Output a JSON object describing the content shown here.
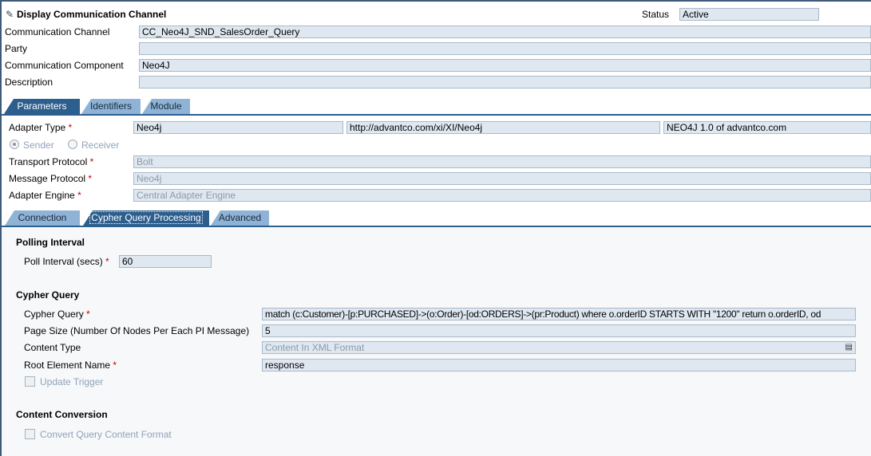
{
  "header": {
    "title": "Display Communication Channel",
    "status_label": "Status",
    "status_value": "Active"
  },
  "fields": {
    "channel": {
      "label": "Communication Channel",
      "value": "CC_Neo4J_SND_SalesOrder_Query"
    },
    "party": {
      "label": "Party",
      "value": ""
    },
    "component": {
      "label": "Communication Component",
      "value": "Neo4J"
    },
    "description": {
      "label": "Description",
      "value": ""
    }
  },
  "tabs": [
    "Parameters",
    "Identifiers",
    "Module"
  ],
  "params": {
    "adapter_type": {
      "label": "Adapter Type",
      "values": [
        "Neo4j",
        "http://advantco.com/xi/XI/Neo4j",
        "NEO4J 1.0 of advantco.com"
      ]
    },
    "sender": "Sender",
    "receiver": "Receiver",
    "transport": {
      "label": "Transport Protocol",
      "value": "Bolt"
    },
    "message": {
      "label": "Message Protocol",
      "value": "Neo4j"
    },
    "engine": {
      "label": "Adapter Engine",
      "value": "Central Adapter Engine"
    },
    "required": "*"
  },
  "subtabs": [
    "Connection",
    "Cypher Query Processing",
    "Advanced"
  ],
  "polling": {
    "heading": "Polling Interval",
    "label": "Poll Interval (secs)",
    "value": "60"
  },
  "cypher": {
    "heading": "Cypher Query",
    "query": {
      "label": "Cypher Query",
      "value": "match (c:Customer)-[p:PURCHASED]->(o:Order)-[od:ORDERS]->(pr:Product) where o.orderID STARTS WITH \"1200\" return o.orderID, od"
    },
    "page_size": {
      "label": "Page Size (Number Of Nodes Per Each PI Message)",
      "value": "5"
    },
    "content_type": {
      "label": "Content Type",
      "value": "Content In XML Format"
    },
    "root": {
      "label": "Root Element Name",
      "value": "response"
    },
    "update_trigger": "Update Trigger"
  },
  "conversion": {
    "heading": "Content Conversion",
    "convert": "Convert Query Content Format"
  }
}
